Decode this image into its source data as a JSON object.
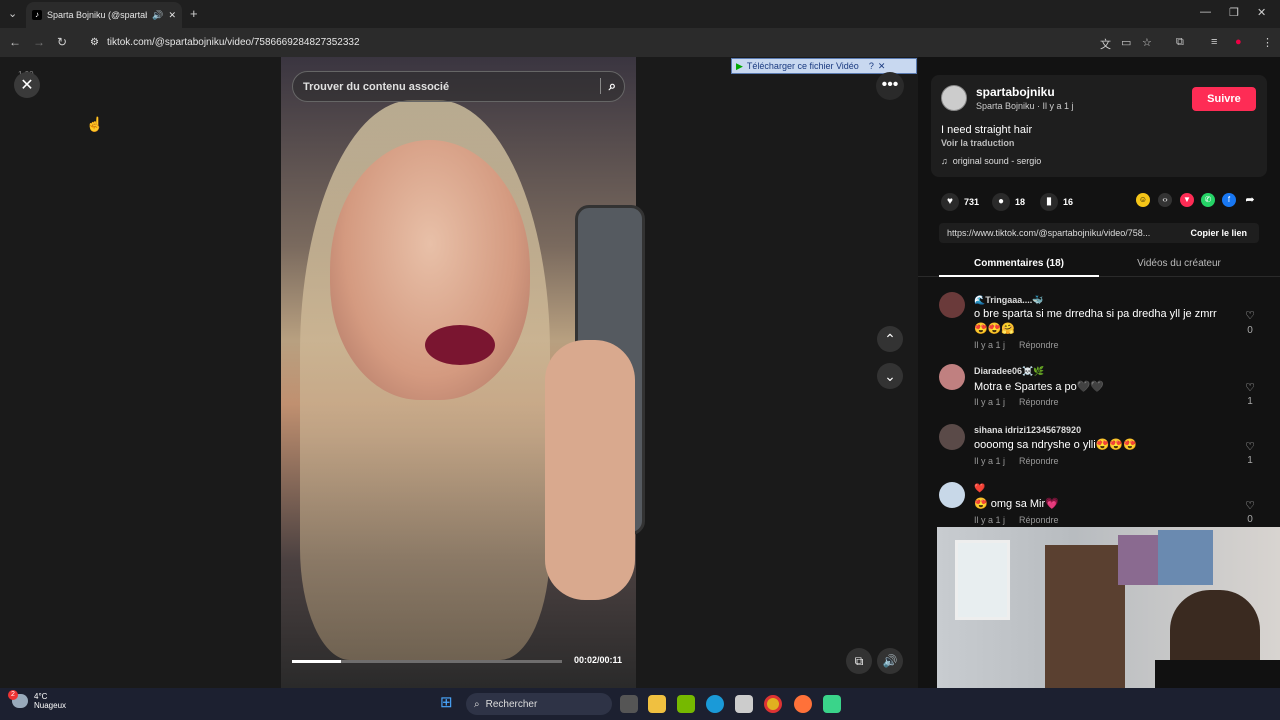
{
  "browser": {
    "tab_title": "Sparta Bojniku (@spartabojniku)",
    "url": "tiktok.com/@spartabojniku/video/7586669284827352332",
    "download_banner": "Télécharger ce fichier Vidéo"
  },
  "player": {
    "zoom": "1.00",
    "search_placeholder": "Trouver du contenu associé",
    "time": "00:02/00:11",
    "progress": 0.18
  },
  "author": {
    "username": "spartabojniku",
    "subline": "Sparta Bojniku · Il y a 1 j",
    "follow_label": "Suivre",
    "description": "I need straight hair",
    "translate_label": "Voir la traduction",
    "sound": "original sound - sergio"
  },
  "stats": {
    "likes": "731",
    "comments": "18",
    "saves": "16"
  },
  "share": {
    "link": "https://www.tiktok.com/@spartabojniku/video/758...",
    "copy_label": "Copier le lien"
  },
  "tabs": {
    "comments": "Commentaires (18)",
    "creator_videos": "Vidéos du créateur"
  },
  "comments": [
    {
      "name": "🌊Tringaaa....🐳",
      "text": "o bre sparta si me drredha si pa dredha yll je zmrr",
      "text2": "😍😍🤗",
      "time": "Il y a 1 j",
      "reply": "Répondre",
      "likes": "0"
    },
    {
      "name": "Diaradee06☠️🌿",
      "text": "Motra e Spartes a po🖤🖤",
      "time": "Il y a 1 j",
      "reply": "Répondre",
      "likes": "1"
    },
    {
      "name": "sihana idrizi12345678920",
      "text": "oooomg sa ndryshe o ylli😍😍😍",
      "time": "Il y a 1 j",
      "reply": "Répondre",
      "likes": "1"
    },
    {
      "name": "❤️",
      "text": "😍 omg sa Mir💗",
      "time": "Il y a 1 j",
      "reply": "Répondre",
      "likes": "0"
    }
  ],
  "taskbar": {
    "temperature": "4°C",
    "weather": "Nuageux",
    "search": "Rechercher",
    "weather_badge": "2"
  }
}
